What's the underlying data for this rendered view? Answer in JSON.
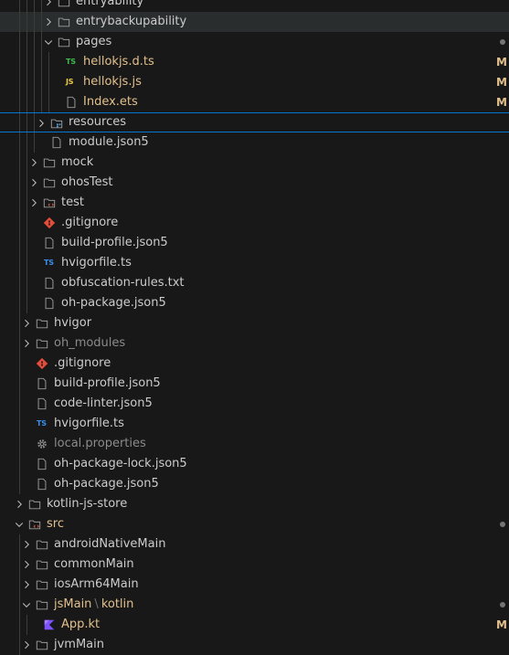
{
  "explorer": {
    "rows": [
      {
        "depth": 3,
        "kind": "folder",
        "collapsed": true,
        "label": "entryability"
      },
      {
        "depth": 3,
        "kind": "folder",
        "collapsed": true,
        "label": "entrybackupability",
        "selected": true
      },
      {
        "depth": 3,
        "kind": "folder",
        "collapsed": false,
        "label": "pages",
        "deco": "dot"
      },
      {
        "depth": 4,
        "kind": "ts",
        "label": "hellokjs.d.ts",
        "modified": true,
        "deco": "M"
      },
      {
        "depth": 4,
        "kind": "js",
        "label": "hellokjs.js",
        "modified": true,
        "deco": "M"
      },
      {
        "depth": 4,
        "kind": "file",
        "label": "Index.ets",
        "modified": true,
        "deco": "M"
      },
      {
        "depth": 2,
        "kind": "folder-res",
        "collapsed": true,
        "label": "resources",
        "focused": true
      },
      {
        "depth": 2,
        "kind": "file",
        "label": "module.json5"
      },
      {
        "depth": 1,
        "kind": "folder",
        "collapsed": true,
        "label": "mock"
      },
      {
        "depth": 1,
        "kind": "folder",
        "collapsed": true,
        "label": "ohosTest"
      },
      {
        "depth": 1,
        "kind": "folder-test",
        "collapsed": true,
        "label": "test"
      },
      {
        "depth": 1,
        "kind": "git",
        "label": ".gitignore"
      },
      {
        "depth": 1,
        "kind": "file",
        "label": "build-profile.json5"
      },
      {
        "depth": 1,
        "kind": "ts",
        "label": "hvigorfile.ts"
      },
      {
        "depth": 1,
        "kind": "file",
        "label": "obfuscation-rules.txt"
      },
      {
        "depth": 1,
        "kind": "file",
        "label": "oh-package.json5"
      },
      {
        "depth": 0,
        "kind": "folder",
        "collapsed": true,
        "label": "hvigor"
      },
      {
        "depth": 0,
        "kind": "folder",
        "collapsed": true,
        "label": "oh_modules",
        "dim": true
      },
      {
        "depth": 0,
        "kind": "git",
        "label": ".gitignore"
      },
      {
        "depth": 0,
        "kind": "file",
        "label": "build-profile.json5"
      },
      {
        "depth": 0,
        "kind": "file",
        "label": "code-linter.json5"
      },
      {
        "depth": 0,
        "kind": "ts",
        "label": "hvigorfile.ts"
      },
      {
        "depth": 0,
        "kind": "gear",
        "label": "local.properties",
        "dim": true
      },
      {
        "depth": 0,
        "kind": "file",
        "label": "oh-package-lock.json5"
      },
      {
        "depth": 0,
        "kind": "file",
        "label": "oh-package.json5"
      },
      {
        "depth": -1,
        "kind": "folder",
        "collapsed": true,
        "label": "kotlin-js-store"
      },
      {
        "depth": -1,
        "kind": "folder-src",
        "collapsed": false,
        "label": "src",
        "modified": true,
        "deco": "dot"
      },
      {
        "depth": 0,
        "kind": "folder",
        "collapsed": true,
        "label": "androidNativeMain"
      },
      {
        "depth": 0,
        "kind": "folder",
        "collapsed": true,
        "label": "commonMain"
      },
      {
        "depth": 0,
        "kind": "folder",
        "collapsed": true,
        "label": "iosArm64Main"
      },
      {
        "depth": 0,
        "kind": "folder",
        "collapsed": false,
        "label": "jsMain",
        "label2": "kotlin",
        "separator": "\\",
        "modified": true,
        "deco": "dot"
      },
      {
        "depth": 1,
        "kind": "kotlin",
        "label": "App.kt",
        "modified": true,
        "deco": "M"
      },
      {
        "depth": 0,
        "kind": "folder",
        "collapsed": true,
        "label": "jvmMain"
      }
    ],
    "guides_x": [
      17,
      25,
      33,
      41,
      49,
      57,
      65,
      73
    ]
  }
}
